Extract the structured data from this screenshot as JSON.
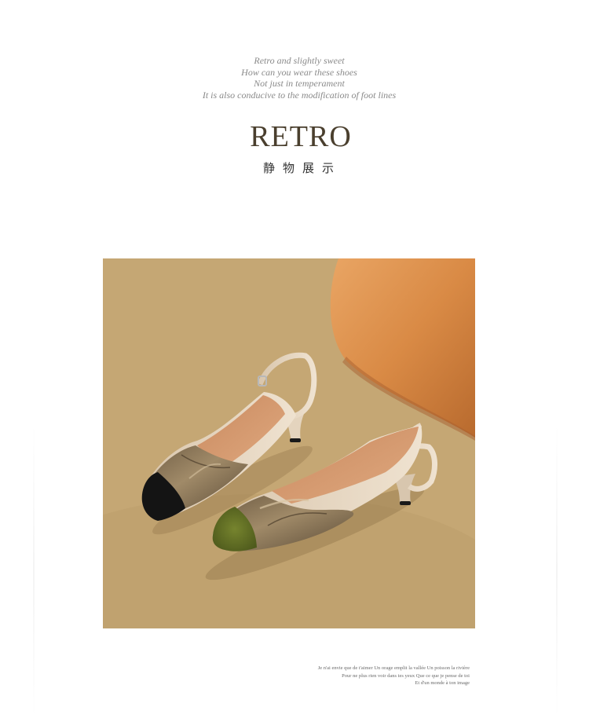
{
  "intro": {
    "lines": [
      "Retro and slightly sweet",
      "How can you wear these shoes",
      "Not just in temperament",
      "It is also conducive to the modification of foot lines"
    ]
  },
  "heading": {
    "title": "RETRO",
    "subtitle": "静物展示"
  },
  "photo": {
    "subject": "two slingback kitten-heel pumps with knotted satin vamp and square toe",
    "colors": {
      "background": "#c4a673",
      "cushion": "#d98a45",
      "satin": "#8a7558",
      "black_toe": "#141414",
      "green_toe": "#5c6a22",
      "cream": "#e6d6c0"
    }
  },
  "caption": {
    "lines": [
      "Je n'ai envie que de t'aimer Un orage emplit la vallée Un poisson la rivière",
      "Pour ne plus rien voir dans tes yeux Que ce que je pense de toi",
      "Et d'un monde à ton image"
    ]
  }
}
